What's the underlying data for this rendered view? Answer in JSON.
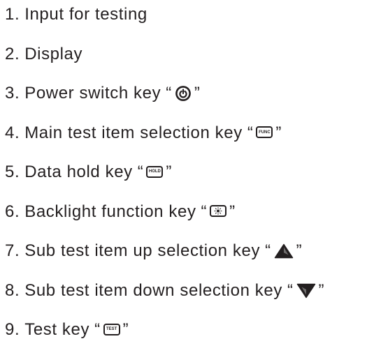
{
  "items": [
    {
      "num": "1.",
      "text": "Input for testing"
    },
    {
      "num": "2.",
      "text": "Display"
    },
    {
      "num": "3.",
      "text": "Power switch key",
      "key_icon": "power-icon"
    },
    {
      "num": "4.",
      "text": "Main test item selection key",
      "key_icon": "func-key-icon",
      "key_label": "FUNC"
    },
    {
      "num": "5.",
      "text": "Data hold key",
      "key_icon": "hold-key-icon",
      "key_label": "HOLD"
    },
    {
      "num": "6.",
      "text": "Backlight function key",
      "key_icon": "backlight-key-icon"
    },
    {
      "num": "7.",
      "text": "Sub test item up selection key",
      "key_icon": "up-triangle-icon"
    },
    {
      "num": "8.",
      "text": "Sub test item down selection key",
      "key_icon": "down-triangle-icon"
    },
    {
      "num": "9.",
      "text": "Test key",
      "key_icon": "test-key-icon",
      "key_label": "TEST"
    }
  ],
  "quote_open": "“",
  "quote_close": "”",
  "text_color": "#231f20"
}
